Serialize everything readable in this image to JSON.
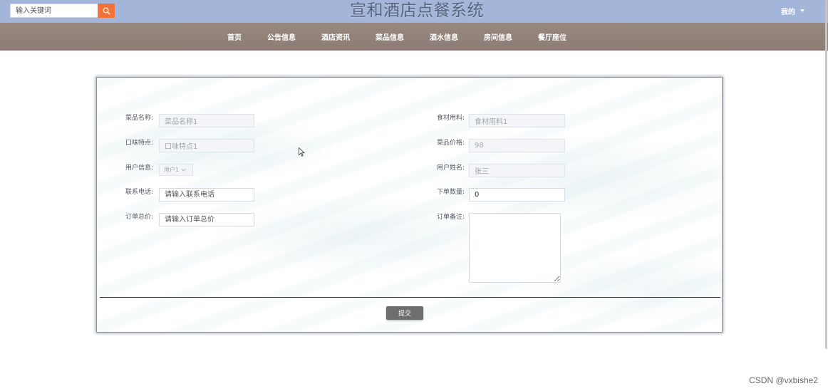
{
  "header": {
    "search": {
      "placeholder": "输入关键词"
    },
    "title": "宣和酒店点餐系统",
    "user_menu": {
      "label": "我的"
    }
  },
  "nav": {
    "items": [
      {
        "label": "首页"
      },
      {
        "label": "公告信息"
      },
      {
        "label": "酒店资讯"
      },
      {
        "label": "菜品信息"
      },
      {
        "label": "酒水信息"
      },
      {
        "label": "房间信息"
      },
      {
        "label": "餐厅座位"
      }
    ]
  },
  "form": {
    "dish_name": {
      "label": "菜品名称:",
      "value": "菜品名称1"
    },
    "taste": {
      "label": "口味特点:",
      "value": "口味特点1"
    },
    "user_info": {
      "label": "用户信息:",
      "selected": "用户1"
    },
    "phone": {
      "label": "联系电话:",
      "placeholder": "请输入联系电话"
    },
    "total_price": {
      "label": "订单总价:",
      "placeholder": "请输入订单总价"
    },
    "ingredients": {
      "label": "食材用料:",
      "value": "食材用料1"
    },
    "dish_price": {
      "label": "菜品价格:",
      "value": "98"
    },
    "user_name": {
      "label": "用户姓名:",
      "value": "张三"
    },
    "quantity": {
      "label": "下单数量:",
      "value": "0"
    },
    "remark": {
      "label": "订单备注:"
    },
    "submit_label": "提交"
  },
  "watermark": "CSDN @vxbishe2",
  "icons": {
    "search_button": "search-icon",
    "user_menu": "caret-down-icon",
    "user_select": "chevron-down-icon"
  },
  "colors": {
    "top_bar": "#a3b6da",
    "nav_bar": "#8c7c75",
    "search_button": "#f2733a",
    "submit_button": "#6e6e6e",
    "title": "#55657e"
  }
}
